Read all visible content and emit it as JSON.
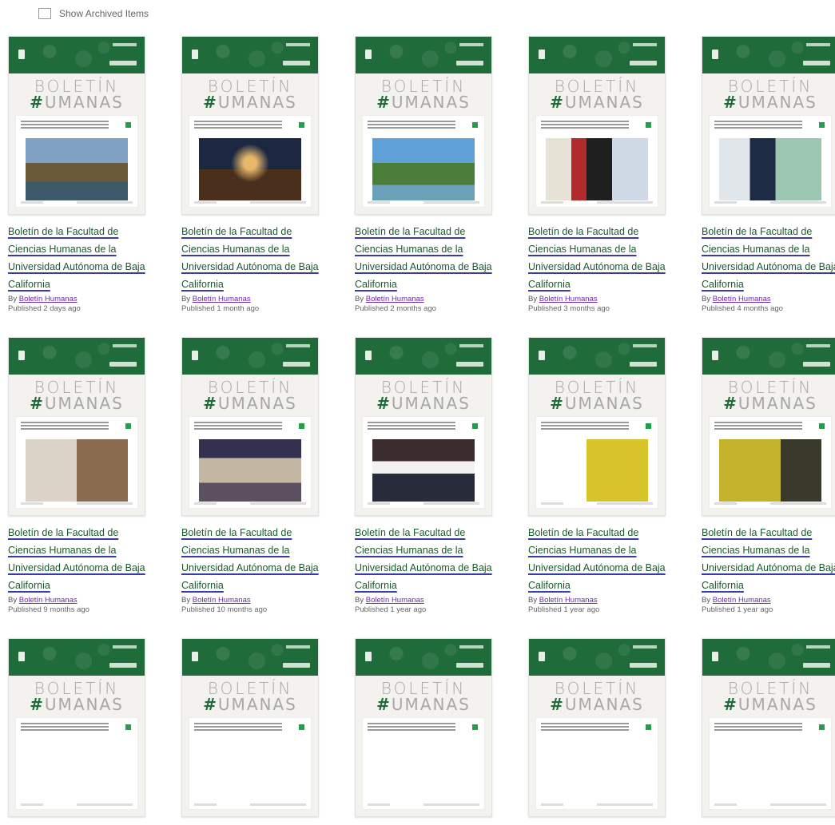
{
  "toolbar": {
    "show_archived_label": "Show Archived Items"
  },
  "cover": {
    "line1": "BOLETÍN",
    "line2_hash": "#",
    "line2_rest": "UMANAS"
  },
  "colors": {
    "band_green": "#1f6b3a",
    "accent_green": "#21a04a"
  },
  "items": [
    {
      "title": "Boletín de la Facultad de Ciencias Humanas de la Universidad Autónoma de Baja California",
      "by": "By",
      "author": "Boletín Humanas",
      "published": "Published 2 days ago",
      "photo": "p1"
    },
    {
      "title": "Boletín de la Facultad de Ciencias Humanas de la Universidad Autónoma de Baja California",
      "by": "By",
      "author": "Boletín Humanas",
      "published": "Published 1 month ago",
      "photo": "p2"
    },
    {
      "title": "Boletín de la Facultad de Ciencias Humanas de la Universidad Autónoma de Baja California",
      "by": "By",
      "author": "Boletín Humanas",
      "published": "Published 2 months ago",
      "photo": "p3"
    },
    {
      "title": "Boletín de la Facultad de Ciencias Humanas de la Universidad Autónoma de Baja California",
      "by": "By",
      "author": "Boletín Humanas",
      "published": "Published 3 months ago",
      "photo": "p4"
    },
    {
      "title": "Boletín de la Facultad de Ciencias Humanas de la Universidad Autónoma de Baja California",
      "by": "By",
      "author": "Boletín Humanas",
      "published": "Published 4 months ago",
      "photo": "p5"
    },
    {
      "title": "Boletín de la Facultad de Ciencias Humanas de la Universidad Autónoma de Baja California",
      "by": "By",
      "author": "Boletín Humanas",
      "published": "Published 9 months ago",
      "photo": "p6"
    },
    {
      "title": "Boletín de la Facultad de Ciencias Humanas de la Universidad Autónoma de Baja California",
      "by": "By",
      "author": "Boletín Humanas",
      "published": "Published 10 months ago",
      "photo": "p7"
    },
    {
      "title": "Boletín de la Facultad de Ciencias Humanas de la Universidad Autónoma de Baja California",
      "by": "By",
      "author": "Boletín Humanas",
      "published": "Published 1 year ago",
      "photo": "p8"
    },
    {
      "title": "Boletín de la Facultad de Ciencias Humanas de la Universidad Autónoma de Baja California",
      "by": "By",
      "author": "Boletín Humanas",
      "published": "Published 1 year ago",
      "photo": "p9"
    },
    {
      "title": "Boletín de la Facultad de Ciencias Humanas de la Universidad Autónoma de Baja California",
      "by": "By",
      "author": "Boletín Humanas",
      "published": "Published 1 year ago",
      "photo": "p10"
    },
    {
      "title": "",
      "by": "",
      "author": "",
      "published": "",
      "photo": "p11"
    },
    {
      "title": "",
      "by": "",
      "author": "",
      "published": "",
      "photo": "p12"
    },
    {
      "title": "",
      "by": "",
      "author": "",
      "published": "",
      "photo": "p13"
    },
    {
      "title": "",
      "by": "",
      "author": "",
      "published": "",
      "photo": "p14"
    },
    {
      "title": "",
      "by": "",
      "author": "",
      "published": "",
      "photo": "p15"
    }
  ]
}
